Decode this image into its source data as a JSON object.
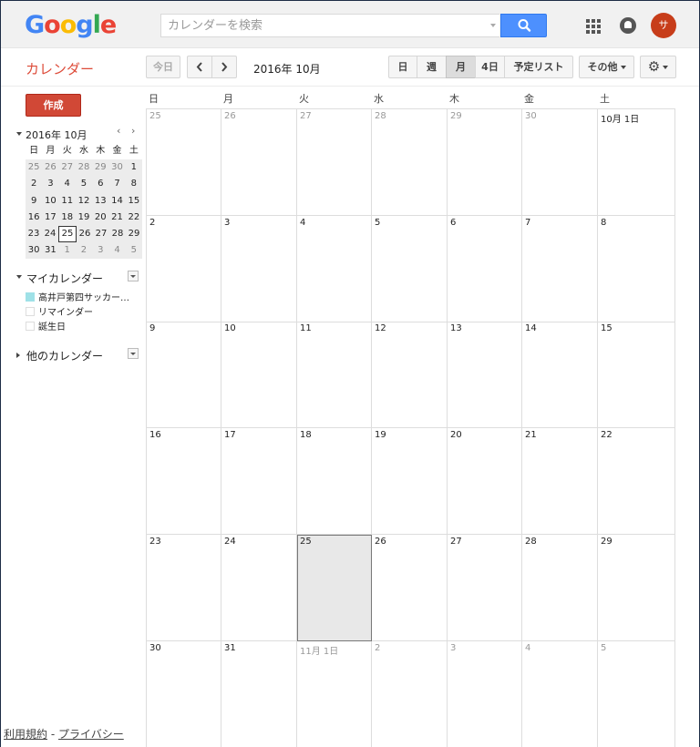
{
  "header": {
    "logo_letters": [
      {
        "ch": "G",
        "color": "#4285f4"
      },
      {
        "ch": "o",
        "color": "#ea4335"
      },
      {
        "ch": "o",
        "color": "#fbbc05"
      },
      {
        "ch": "g",
        "color": "#4285f4"
      },
      {
        "ch": "l",
        "color": "#34a853"
      },
      {
        "ch": "e",
        "color": "#ea4335"
      }
    ],
    "search_placeholder": "カレンダーを検索",
    "avatar_initial": "サ"
  },
  "toolbar": {
    "app_title": "カレンダー",
    "today_label": "今日",
    "prev_label": "〈",
    "next_label": "〉",
    "current_range": "2016年 10月",
    "views": {
      "day": "日",
      "week": "週",
      "month": "月",
      "four_day": "4日",
      "agenda": "予定リスト"
    },
    "active_view": "month",
    "more_label": "その他",
    "settings_icon": "gear-icon"
  },
  "sidebar": {
    "create_label": "作成",
    "mini_calendar": {
      "title": "2016年 10月",
      "prev": "‹",
      "next": "›",
      "dow": [
        "日",
        "月",
        "火",
        "水",
        "木",
        "金",
        "土"
      ],
      "weeks": [
        [
          {
            "d": "25",
            "o": true
          },
          {
            "d": "26",
            "o": true
          },
          {
            "d": "27",
            "o": true
          },
          {
            "d": "28",
            "o": true
          },
          {
            "d": "29",
            "o": true
          },
          {
            "d": "30",
            "o": true
          },
          {
            "d": "1",
            "o": false
          }
        ],
        [
          {
            "d": "2",
            "o": false
          },
          {
            "d": "3",
            "o": false
          },
          {
            "d": "4",
            "o": false
          },
          {
            "d": "5",
            "o": false
          },
          {
            "d": "6",
            "o": false
          },
          {
            "d": "7",
            "o": false
          },
          {
            "d": "8",
            "o": false
          }
        ],
        [
          {
            "d": "9",
            "o": false
          },
          {
            "d": "10",
            "o": false
          },
          {
            "d": "11",
            "o": false
          },
          {
            "d": "12",
            "o": false
          },
          {
            "d": "13",
            "o": false
          },
          {
            "d": "14",
            "o": false
          },
          {
            "d": "15",
            "o": false
          }
        ],
        [
          {
            "d": "16",
            "o": false
          },
          {
            "d": "17",
            "o": false
          },
          {
            "d": "18",
            "o": false
          },
          {
            "d": "19",
            "o": false
          },
          {
            "d": "20",
            "o": false
          },
          {
            "d": "21",
            "o": false
          },
          {
            "d": "22",
            "o": false
          }
        ],
        [
          {
            "d": "23",
            "o": false
          },
          {
            "d": "24",
            "o": false
          },
          {
            "d": "25",
            "o": false,
            "sel": true
          },
          {
            "d": "26",
            "o": false
          },
          {
            "d": "27",
            "o": false
          },
          {
            "d": "28",
            "o": false
          },
          {
            "d": "29",
            "o": false
          }
        ],
        [
          {
            "d": "30",
            "o": false
          },
          {
            "d": "31",
            "o": false
          },
          {
            "d": "1",
            "o": true
          },
          {
            "d": "2",
            "o": true
          },
          {
            "d": "3",
            "o": true
          },
          {
            "d": "4",
            "o": true
          },
          {
            "d": "5",
            "o": true
          }
        ]
      ]
    },
    "my_calendars": {
      "title": "マイカレンダー",
      "items": [
        {
          "label": "高井戸第四サッカー…",
          "checked": true,
          "color": "#9fe1e7"
        },
        {
          "label": "リマインダー",
          "checked": false
        },
        {
          "label": "誕生日",
          "checked": false
        }
      ]
    },
    "other_calendars": {
      "title": "他のカレンダー"
    },
    "footer": {
      "terms": "利用規約",
      "separator": " - ",
      "privacy": "プライバシー"
    }
  },
  "month_view": {
    "dow": [
      "日",
      "月",
      "火",
      "水",
      "木",
      "金",
      "土"
    ],
    "weeks": [
      [
        {
          "d": "25",
          "o": true
        },
        {
          "d": "26",
          "o": true
        },
        {
          "d": "27",
          "o": true
        },
        {
          "d": "28",
          "o": true
        },
        {
          "d": "29",
          "o": true
        },
        {
          "d": "30",
          "o": true
        },
        {
          "d": "10月 1日",
          "o": false
        }
      ],
      [
        {
          "d": "2",
          "o": false
        },
        {
          "d": "3",
          "o": false
        },
        {
          "d": "4",
          "o": false
        },
        {
          "d": "5",
          "o": false
        },
        {
          "d": "6",
          "o": false
        },
        {
          "d": "7",
          "o": false
        },
        {
          "d": "8",
          "o": false
        }
      ],
      [
        {
          "d": "9",
          "o": false
        },
        {
          "d": "10",
          "o": false
        },
        {
          "d": "11",
          "o": false
        },
        {
          "d": "12",
          "o": false
        },
        {
          "d": "13",
          "o": false
        },
        {
          "d": "14",
          "o": false
        },
        {
          "d": "15",
          "o": false
        }
      ],
      [
        {
          "d": "16",
          "o": false
        },
        {
          "d": "17",
          "o": false
        },
        {
          "d": "18",
          "o": false
        },
        {
          "d": "19",
          "o": false
        },
        {
          "d": "20",
          "o": false
        },
        {
          "d": "21",
          "o": false
        },
        {
          "d": "22",
          "o": false
        }
      ],
      [
        {
          "d": "23",
          "o": false
        },
        {
          "d": "24",
          "o": false
        },
        {
          "d": "25",
          "o": false,
          "today": true
        },
        {
          "d": "26",
          "o": false
        },
        {
          "d": "27",
          "o": false
        },
        {
          "d": "28",
          "o": false
        },
        {
          "d": "29",
          "o": false
        }
      ],
      [
        {
          "d": "30",
          "o": false
        },
        {
          "d": "31",
          "o": false
        },
        {
          "d": "11月 1日",
          "o": true
        },
        {
          "d": "2",
          "o": true
        },
        {
          "d": "3",
          "o": true
        },
        {
          "d": "4",
          "o": true
        },
        {
          "d": "5",
          "o": true
        }
      ]
    ]
  }
}
